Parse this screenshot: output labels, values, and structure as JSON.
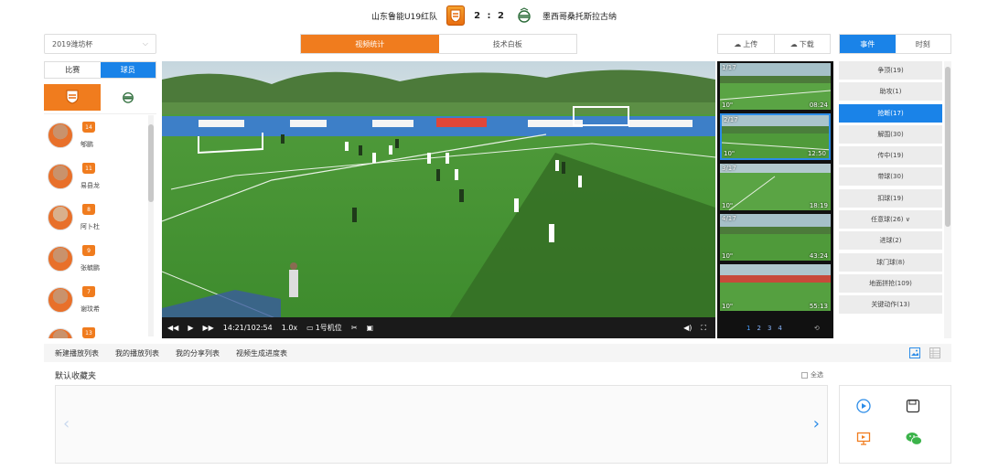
{
  "match": {
    "home_team": "山东鲁能U19红队",
    "score": "2 : 2",
    "away_team": "墨西哥桑托斯拉古纳"
  },
  "left": {
    "cup_select": "2019潍坊杯",
    "segment": [
      "比赛",
      "球员"
    ],
    "segment_active": 1,
    "players": [
      {
        "number": "14",
        "name": "郇鹏"
      },
      {
        "number": "11",
        "name": "易县龙"
      },
      {
        "number": "8",
        "name": "阿卜杜"
      },
      {
        "number": "9",
        "name": "张毓鹏"
      },
      {
        "number": "7",
        "name": "谢玟希"
      },
      {
        "number": "13",
        "name": ""
      }
    ]
  },
  "center_tabs": [
    "视频统计",
    "技术白板"
  ],
  "center_tab_active": 0,
  "top_buttons": {
    "upload": "上传",
    "download": "下载"
  },
  "right_tabs": [
    "事件",
    "时刻"
  ],
  "right_tab_active": 0,
  "player_controls": {
    "time": "14:21/102:54",
    "speed": "1.0x",
    "camera": "1号机位"
  },
  "clips": [
    {
      "index": "1/17",
      "duration": "10\"",
      "time": "08:24"
    },
    {
      "index": "2/17",
      "duration": "10\"",
      "time": "12:50"
    },
    {
      "index": "3/17",
      "duration": "10\"",
      "time": "18:19"
    },
    {
      "index": "4/17",
      "duration": "10\"",
      "time": "43:24"
    },
    {
      "index": "",
      "duration": "10\"",
      "time": "55:13"
    }
  ],
  "clip_selected": 1,
  "clip_pages": [
    "1",
    "2",
    "3",
    "4"
  ],
  "events": [
    "争顶(19)",
    "助攻(1)",
    "抢断(17)",
    "解围(30)",
    "传中(19)",
    "带球(30)",
    "扣球(19)",
    "任意球(26) ∨",
    "进球(2)",
    "球门球(8)",
    "地面拼抢(109)",
    "关键动作(13)"
  ],
  "event_active": 2,
  "bottom_tabs": [
    "新建播放列表",
    "我的播放列表",
    "我的分享列表",
    "视频生成进度表"
  ],
  "favorites_title": "默认收藏夹",
  "select_all": "全选",
  "colors": {
    "orange": "#f07c1e",
    "blue": "#1a83e8"
  }
}
